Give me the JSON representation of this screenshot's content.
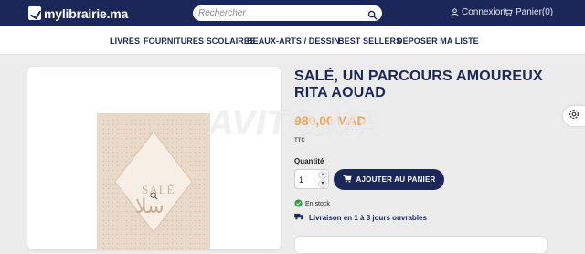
{
  "header": {
    "logo_text": "mylibrairie.ma",
    "search_placeholder": "Rechercher",
    "login_label": "Connexion",
    "cart_label": "Panier(0)"
  },
  "nav": {
    "items": [
      "LIVRES",
      "FOURNITURES SCOLAIRES",
      "BEAUX-ARTS / DESSIN",
      "BEST SELLERS",
      "DÉPOSER MA LISTE"
    ]
  },
  "product": {
    "title_line1": "SALÉ, UN PARCOURS AMOUREUX",
    "title_line2": "RITA AOUAD",
    "price": "980,00 MAD",
    "tax_note": "TTC",
    "quantity_label": "Quantité",
    "quantity_value": "1",
    "add_to_cart_label": "AJOUTER AU PANIER",
    "stock_status": "En stock",
    "delivery_note": "Livraison en 1 à 3 jours ouvrables",
    "cover_title": "SALÉ",
    "cover_arabic": "سلا"
  },
  "watermark": "AVITO.MA",
  "colors": {
    "brand_navy": "#1b2759",
    "price_orange": "#f0a35a",
    "stock_green": "#2e9b3e",
    "page_bg": "#ececec"
  },
  "icons": [
    "logo-icon",
    "search-icon",
    "user-icon",
    "cart-icon",
    "zoom-icon",
    "cart-add-icon",
    "check-circle-icon",
    "truck-icon",
    "gear-icon"
  ]
}
